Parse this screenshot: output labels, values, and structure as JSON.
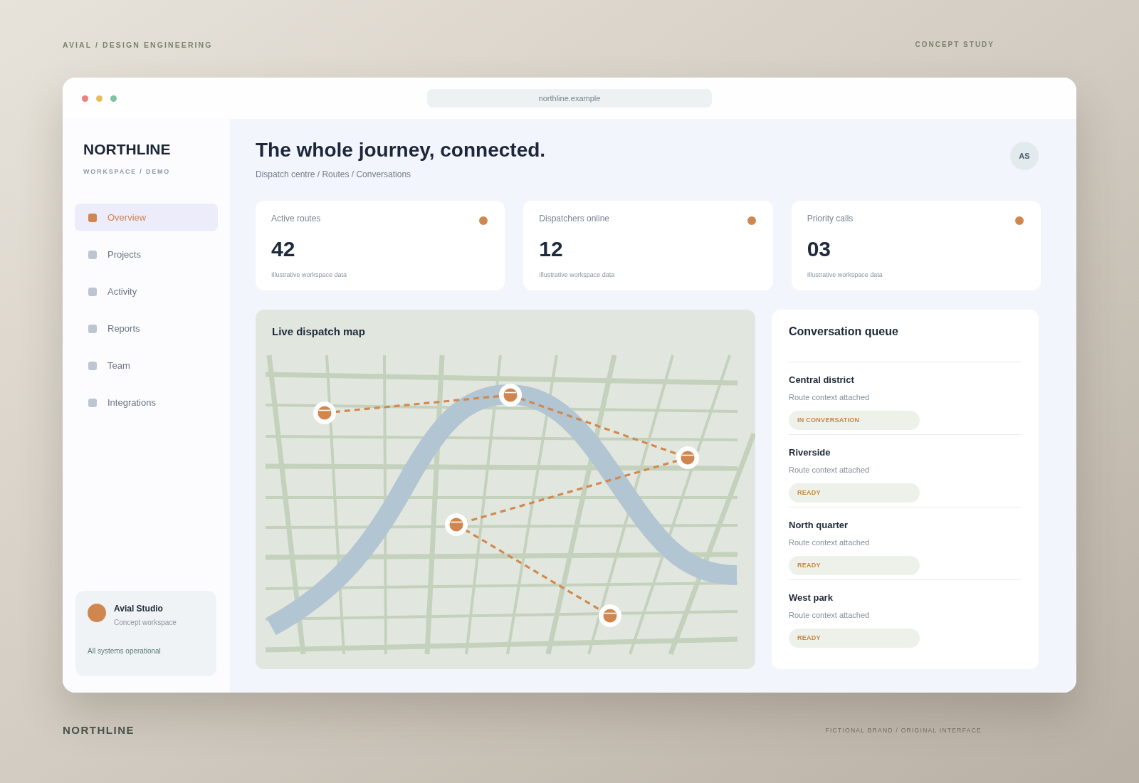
{
  "frame": {
    "label": "AVIAL / DESIGN ENGINEERING",
    "tag": "CONCEPT STUDY",
    "footer_brand": "NORTHLINE",
    "footer_note": "FICTIONAL BRAND / ORIGINAL INTERFACE"
  },
  "browser": {
    "url": "northline.example"
  },
  "sidebar": {
    "brand": "NORTHLINE",
    "subtitle": "WORKSPACE / DEMO",
    "items": [
      {
        "label": "Overview",
        "selected": true
      },
      {
        "label": "Projects",
        "selected": false
      },
      {
        "label": "Activity",
        "selected": false
      },
      {
        "label": "Reports",
        "selected": false
      },
      {
        "label": "Team",
        "selected": false
      },
      {
        "label": "Integrations",
        "selected": false
      }
    ],
    "workspace": {
      "name": "Avial Studio",
      "subtitle": "Concept workspace",
      "status": "All systems operational"
    }
  },
  "header": {
    "title": "The whole journey, connected.",
    "breadcrumb": "Dispatch centre / Routes / Conversations",
    "avatar": "AS"
  },
  "stats": [
    {
      "label": "Active routes",
      "value": "42",
      "note": "Illustrative workspace data"
    },
    {
      "label": "Dispatchers online",
      "value": "12",
      "note": "Illustrative workspace data"
    },
    {
      "label": "Priority calls",
      "value": "03",
      "note": "Illustrative workspace data"
    }
  ],
  "map": {
    "title": "Live dispatch map"
  },
  "queue": {
    "title": "Conversation queue",
    "items": [
      {
        "name": "Central district",
        "note": "Route context attached",
        "status": "IN CONVERSATION"
      },
      {
        "name": "Riverside",
        "note": "Route context attached",
        "status": "READY"
      },
      {
        "name": "North quarter",
        "note": "Route context attached",
        "status": "READY"
      },
      {
        "name": "West park",
        "note": "Route context attached",
        "status": "READY"
      }
    ]
  }
}
